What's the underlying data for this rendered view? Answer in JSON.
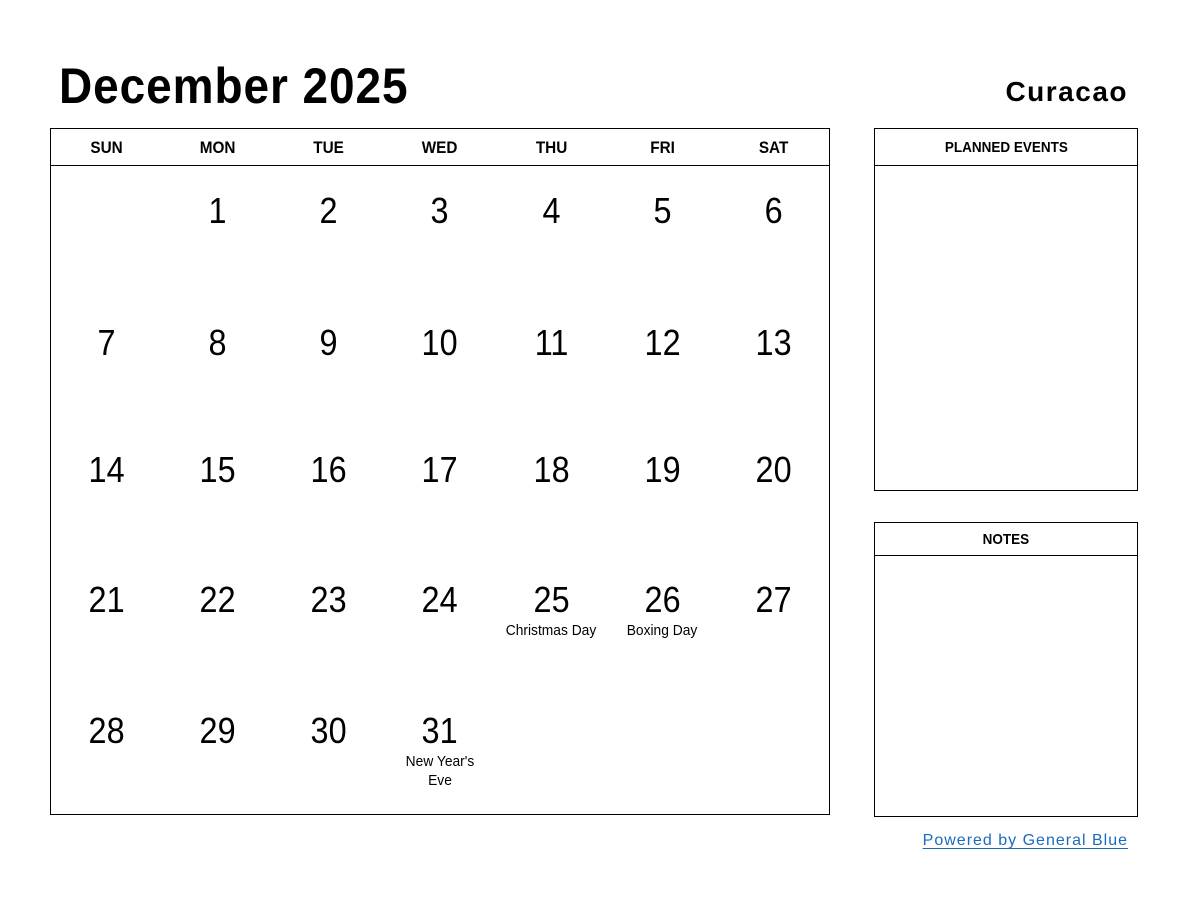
{
  "header": {
    "title": "December 2025",
    "region": "Curacao"
  },
  "calendar": {
    "days_of_week": [
      "SUN",
      "MON",
      "TUE",
      "WED",
      "THU",
      "FRI",
      "SAT"
    ],
    "weeks": [
      [
        {
          "day": "",
          "holiday": ""
        },
        {
          "day": "1",
          "holiday": ""
        },
        {
          "day": "2",
          "holiday": ""
        },
        {
          "day": "3",
          "holiday": ""
        },
        {
          "day": "4",
          "holiday": ""
        },
        {
          "day": "5",
          "holiday": ""
        },
        {
          "day": "6",
          "holiday": ""
        }
      ],
      [
        {
          "day": "7",
          "holiday": ""
        },
        {
          "day": "8",
          "holiday": ""
        },
        {
          "day": "9",
          "holiday": ""
        },
        {
          "day": "10",
          "holiday": ""
        },
        {
          "day": "11",
          "holiday": ""
        },
        {
          "day": "12",
          "holiday": ""
        },
        {
          "day": "13",
          "holiday": ""
        }
      ],
      [
        {
          "day": "14",
          "holiday": ""
        },
        {
          "day": "15",
          "holiday": ""
        },
        {
          "day": "16",
          "holiday": ""
        },
        {
          "day": "17",
          "holiday": ""
        },
        {
          "day": "18",
          "holiday": ""
        },
        {
          "day": "19",
          "holiday": ""
        },
        {
          "day": "20",
          "holiday": ""
        }
      ],
      [
        {
          "day": "21",
          "holiday": ""
        },
        {
          "day": "22",
          "holiday": ""
        },
        {
          "day": "23",
          "holiday": ""
        },
        {
          "day": "24",
          "holiday": ""
        },
        {
          "day": "25",
          "holiday": "Christmas Day"
        },
        {
          "day": "26",
          "holiday": "Boxing Day"
        },
        {
          "day": "27",
          "holiday": ""
        }
      ],
      [
        {
          "day": "28",
          "holiday": ""
        },
        {
          "day": "29",
          "holiday": ""
        },
        {
          "day": "30",
          "holiday": ""
        },
        {
          "day": "31",
          "holiday": "New Year's Eve"
        },
        {
          "day": "",
          "holiday": ""
        },
        {
          "day": "",
          "holiday": ""
        },
        {
          "day": "",
          "holiday": ""
        }
      ]
    ]
  },
  "panels": {
    "planned_events": {
      "title": "PLANNED EVENTS"
    },
    "notes": {
      "title": "NOTES"
    }
  },
  "footer": {
    "powered_by": "Powered by General Blue",
    "link_color": "#1a6bbd"
  }
}
